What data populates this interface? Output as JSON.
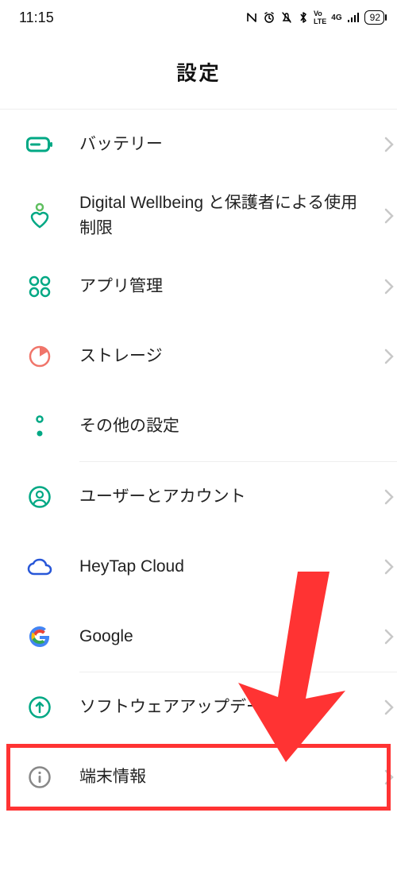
{
  "statusbar": {
    "time": "11:15",
    "battery": "92"
  },
  "header": {
    "title": "設定"
  },
  "items": [
    {
      "label": "バッテリー"
    },
    {
      "label": "Digital Wellbeing と保護者による使用制限"
    },
    {
      "label": "アプリ管理"
    },
    {
      "label": "ストレージ"
    },
    {
      "label": "その他の設定"
    },
    {
      "label": "ユーザーとアカウント"
    },
    {
      "label": "HeyTap Cloud"
    },
    {
      "label": "Google"
    },
    {
      "label": "ソフトウェアアップデート"
    },
    {
      "label": "端末情報"
    }
  ]
}
